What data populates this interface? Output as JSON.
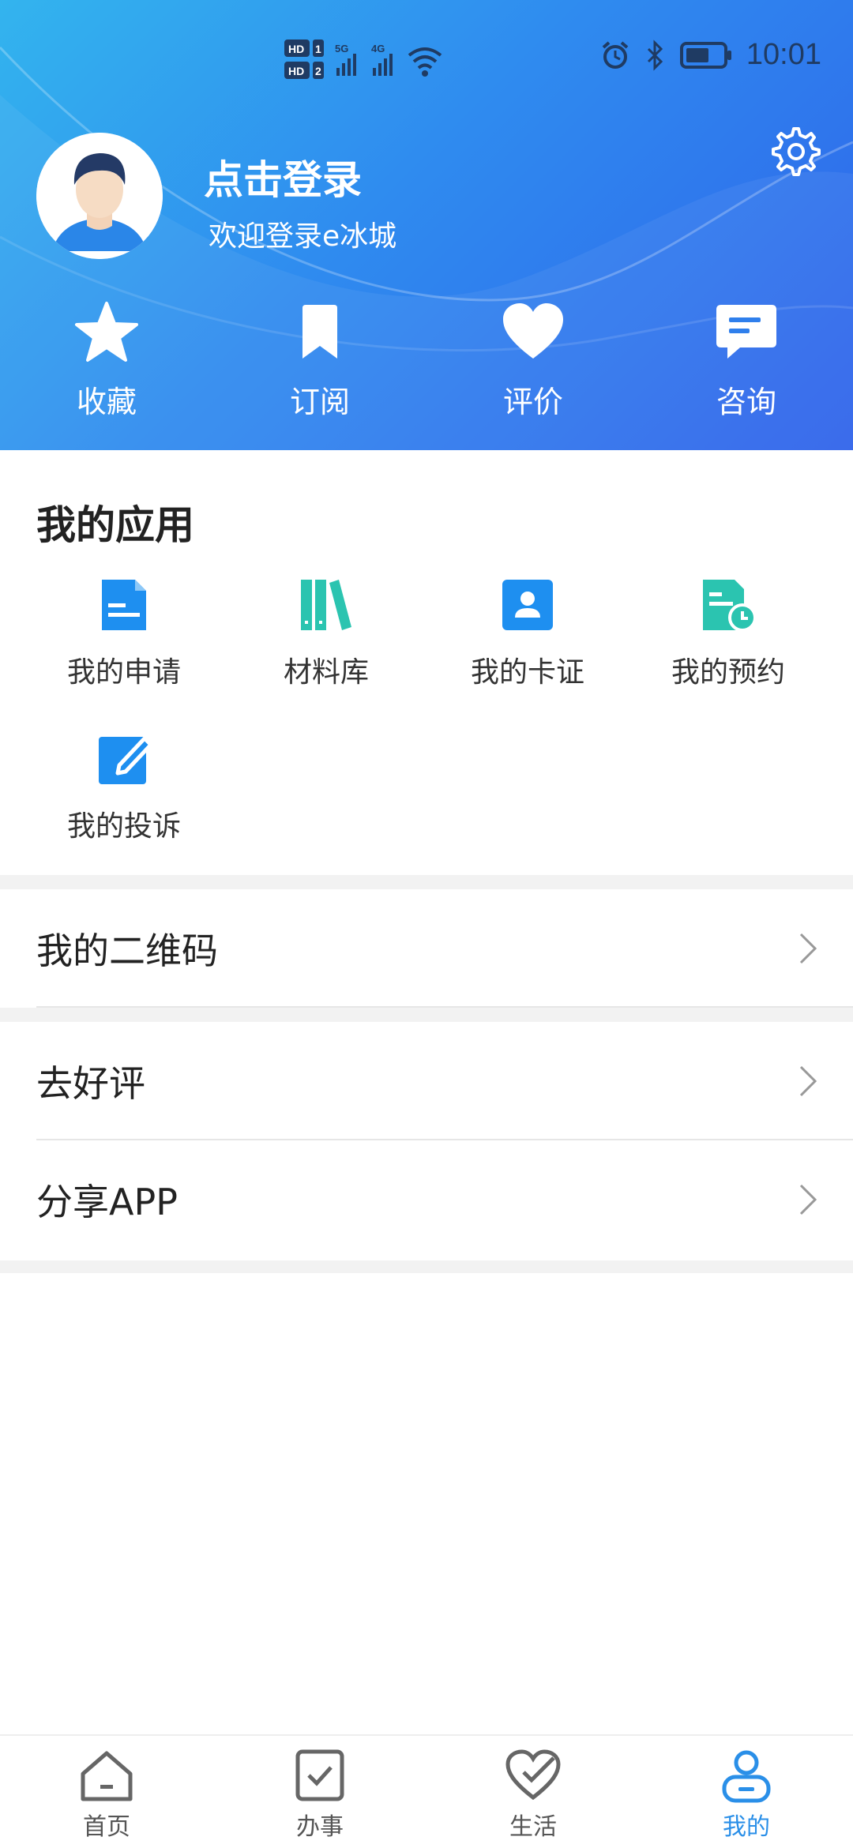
{
  "status_bar": {
    "network_left": "HD 1 / HD 2",
    "signal_1": "5G",
    "signal_2": "4G",
    "time": "10:01"
  },
  "header": {
    "login_title": "点击登录",
    "login_subtitle": "欢迎登录e冰城",
    "quick_actions": [
      {
        "label": "收藏",
        "icon": "star-icon"
      },
      {
        "label": "订阅",
        "icon": "bookmark-icon"
      },
      {
        "label": "评价",
        "icon": "heart-icon"
      },
      {
        "label": "咨询",
        "icon": "chat-icon"
      }
    ]
  },
  "apps": {
    "title": "我的应用",
    "items": [
      {
        "label": "我的申请",
        "icon": "document-icon"
      },
      {
        "label": "材料库",
        "icon": "books-icon"
      },
      {
        "label": "我的卡证",
        "icon": "id-card-icon"
      },
      {
        "label": "我的预约",
        "icon": "appointment-icon"
      },
      {
        "label": "我的投诉",
        "icon": "edit-icon"
      }
    ]
  },
  "list": {
    "qrcode": "我的二维码",
    "review": "去好评",
    "share": "分享APP"
  },
  "bottom_nav": {
    "items": [
      {
        "label": "首页"
      },
      {
        "label": "办事"
      },
      {
        "label": "生活"
      },
      {
        "label": "我的"
      }
    ],
    "active_color": "#2a8fe8"
  },
  "colors": {
    "header_gradient_start": "#33b4ee",
    "header_gradient_end": "#2f62ea",
    "app_blue": "#1e8ff0",
    "app_teal": "#2bc4b0"
  }
}
